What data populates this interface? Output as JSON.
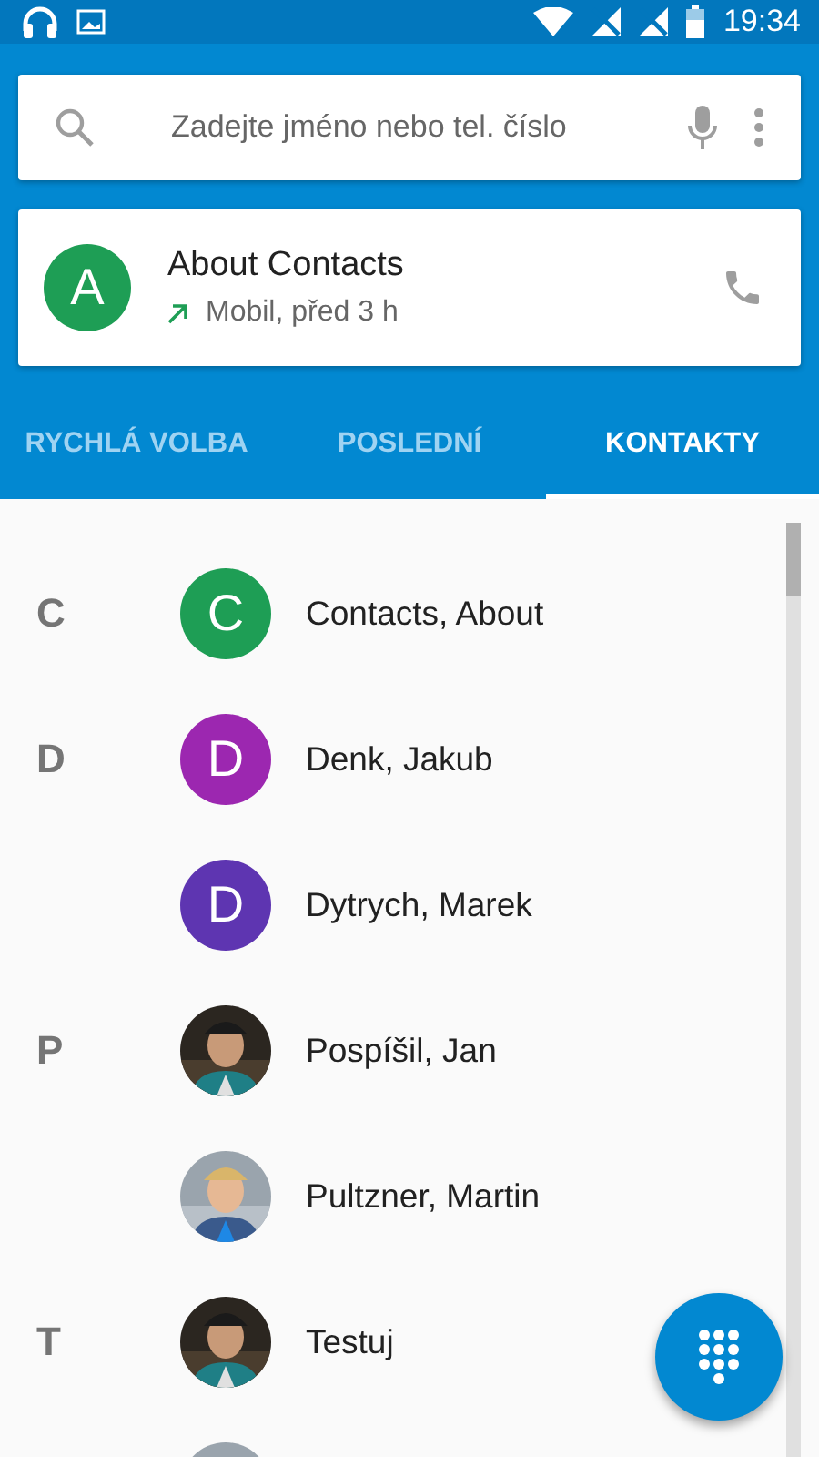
{
  "status_bar": {
    "time": "19:34"
  },
  "search": {
    "placeholder": "Zadejte jméno nebo tel. číslo"
  },
  "recent_call": {
    "initial": "A",
    "color": "#1e9e55",
    "name": "About Contacts",
    "detail": "Mobil, před 3 h"
  },
  "tabs": [
    {
      "label": "RYCHLÁ VOLBA",
      "selected": false
    },
    {
      "label": "POSLEDNÍ",
      "selected": false
    },
    {
      "label": "KONTAKTY",
      "selected": true
    }
  ],
  "contacts": [
    {
      "section": "C",
      "name": "Contacts, About",
      "avatar": {
        "kind": "letter",
        "initial": "C",
        "color": "#1e9e55"
      }
    },
    {
      "section": "D",
      "name": "Denk, Jakub",
      "avatar": {
        "kind": "letter",
        "initial": "D",
        "color": "#9c27b0"
      }
    },
    {
      "name": "Dytrych, Marek",
      "avatar": {
        "kind": "letter",
        "initial": "D",
        "color": "#5e35b1"
      }
    },
    {
      "section": "P",
      "name": "Pospíšil, Jan",
      "avatar": {
        "kind": "picture"
      }
    },
    {
      "name": "Pultzner, Martin",
      "avatar": {
        "kind": "picture"
      }
    },
    {
      "section": "T",
      "name": "Testuj",
      "avatar": {
        "kind": "picture"
      }
    },
    {
      "avatar": {
        "kind": "picture"
      }
    }
  ]
}
